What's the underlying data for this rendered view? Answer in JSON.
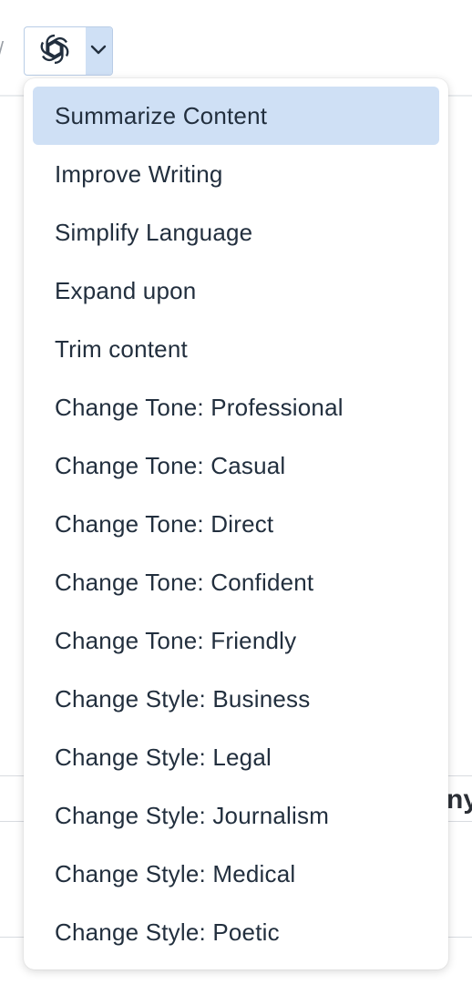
{
  "toolbar": {
    "ai_button_icon": "openai-logo-icon",
    "dropdown_icon": "chevron-down-icon",
    "accent_color": "#cfe0f5"
  },
  "menu": {
    "items": [
      {
        "label": "Summarize Content",
        "active": true
      },
      {
        "label": "Improve Writing"
      },
      {
        "label": "Simplify Language"
      },
      {
        "label": "Expand upon"
      },
      {
        "label": "Trim content"
      },
      {
        "label": "Change Tone: Professional"
      },
      {
        "label": "Change Tone: Casual"
      },
      {
        "label": "Change Tone: Direct"
      },
      {
        "label": "Change Tone: Confident"
      },
      {
        "label": "Change Tone: Friendly"
      },
      {
        "label": "Change Style: Business"
      },
      {
        "label": "Change Style: Legal"
      },
      {
        "label": "Change Style: Journalism"
      },
      {
        "label": "Change Style: Medical"
      },
      {
        "label": "Change Style: Poetic"
      }
    ]
  },
  "background": {
    "table_fragment_text": "ny"
  }
}
